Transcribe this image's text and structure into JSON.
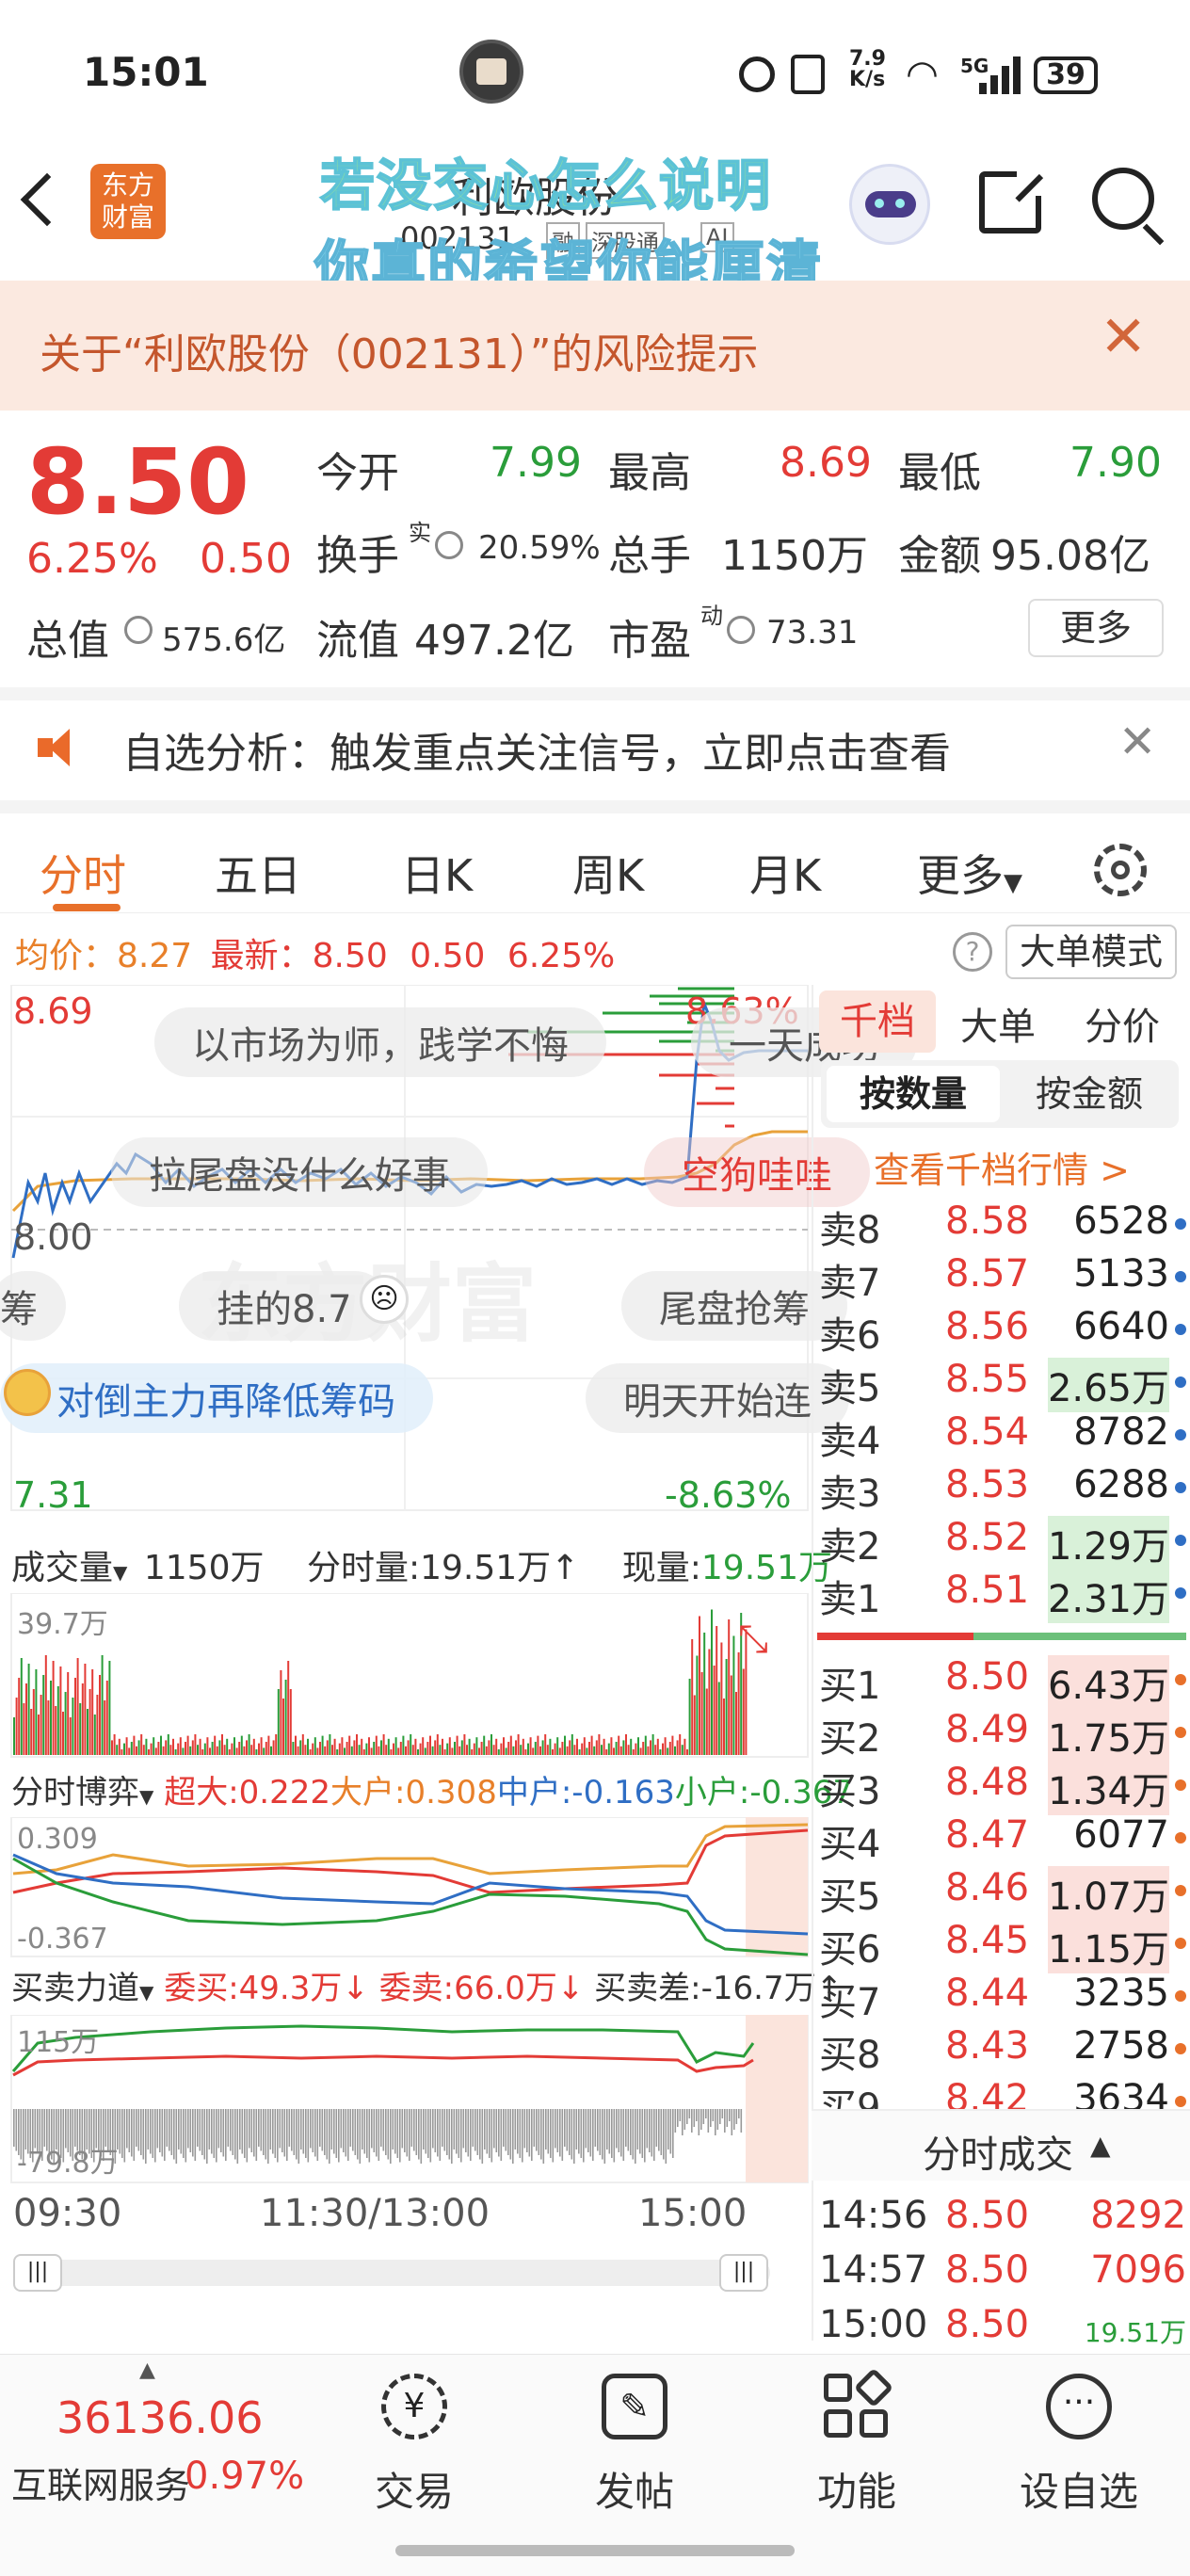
{
  "status_bar": {
    "time": "15:01",
    "net_speed_top": "7.9",
    "net_speed_unit": "K/s",
    "signal_label": "5G",
    "battery": "39"
  },
  "nav": {
    "logo_top": "东方",
    "logo_bottom": "财富",
    "stock_name": "利欧股份",
    "stock_code": "002131",
    "tags": [
      "融",
      "深股通",
      "AI"
    ],
    "overlay_line1": "若没交心怎么说明",
    "overlay_line2": "你真的希望你能厘清"
  },
  "banner": {
    "text": "关于“利欧股份（002131）”的风险提示"
  },
  "quote": {
    "price": "8.50",
    "change_pct": "6.25%",
    "change": "0.50",
    "open_label": "今开",
    "open": "7.99",
    "high_label": "最高",
    "high": "8.69",
    "low_label": "最低",
    "low": "7.90",
    "turnover_label": "换手",
    "turnover_sup": "实",
    "turnover": "20.59%",
    "volume_label": "总手",
    "volume": "1150万",
    "amount_label": "金额",
    "amount": "95.08亿",
    "mktcap_label": "总值",
    "mktcap": "575.6亿",
    "float_label": "流值",
    "float": "497.2亿",
    "pe_label": "市盈",
    "pe_sup": "动",
    "pe": "73.31",
    "more": "更多"
  },
  "notice": {
    "text": "自选分析：触发重点关注信号，立即点击查看"
  },
  "tabs": [
    "分时",
    "五日",
    "日K",
    "周K",
    "月K",
    "更多"
  ],
  "chart": {
    "avg_label": "均价：",
    "avg": "8.27",
    "latest_label": "最新：",
    "latest": "8.50",
    "latest_chg": "0.50",
    "latest_pct": "6.25%",
    "mode_button": "大单模式",
    "y_high": "8.69",
    "y_high_pct": "8.63%",
    "y_mid": "8.00",
    "y_low": "7.31",
    "y_low_pct": "-8.63%",
    "vol_label": "成交量",
    "vol_total": "1150万",
    "vol_fs_label": "分时量:",
    "vol_fs": "19.51万↑",
    "vol_now_label": "现量:",
    "vol_now": "19.51万",
    "vol_max": "39.7万",
    "game_label": "分时博弈",
    "game_super_label": "超大:",
    "game_super": "0.222",
    "game_big_label": "大户:",
    "game_big": "0.308",
    "game_mid_label": "中户:",
    "game_mid": "-0.163",
    "game_small_label": "小户:",
    "game_small": "-0.367",
    "game_top": "0.309",
    "game_bot": "-0.367",
    "force_label": "买卖力道",
    "force_buy_label": "委买:",
    "force_buy": "49.3万↓",
    "force_sell_label": "委卖:",
    "force_sell": "66.0万↓",
    "force_diff_label": "买卖差:",
    "force_diff": "-16.7万↑",
    "force_top": "115万",
    "force_bot": "-79.8万",
    "time_start": "09:30",
    "time_mid": "11:30/13:00",
    "time_end": "15:00"
  },
  "danmaku": [
    "以市场为师，践学不悔",
    "一天成功",
    "拉尾盘没什么好事",
    "空狗哇哇",
    "挂的8.7",
    "尾盘抢筹",
    "对倒主力再降低筹码",
    "明天开始连",
    "筹",
    "东方财富"
  ],
  "orderbook": {
    "tabs": [
      "千档",
      "大单",
      "分价"
    ],
    "sub_tabs": [
      "按数量",
      "按金额"
    ],
    "link": "查看千档行情 >",
    "sells": [
      {
        "l": "卖8",
        "p": "8.58",
        "v": "6528"
      },
      {
        "l": "卖7",
        "p": "8.57",
        "v": "5133"
      },
      {
        "l": "卖6",
        "p": "8.56",
        "v": "6640"
      },
      {
        "l": "卖5",
        "p": "8.55",
        "v": "2.65万"
      },
      {
        "l": "卖4",
        "p": "8.54",
        "v": "8782"
      },
      {
        "l": "卖3",
        "p": "8.53",
        "v": "6288"
      },
      {
        "l": "卖2",
        "p": "8.52",
        "v": "1.29万"
      },
      {
        "l": "卖1",
        "p": "8.51",
        "v": "2.31万"
      }
    ],
    "buys": [
      {
        "l": "买1",
        "p": "8.50",
        "v": "6.43万"
      },
      {
        "l": "买2",
        "p": "8.49",
        "v": "1.75万"
      },
      {
        "l": "买3",
        "p": "8.48",
        "v": "1.34万"
      },
      {
        "l": "买4",
        "p": "8.47",
        "v": "6077"
      },
      {
        "l": "买5",
        "p": "8.46",
        "v": "1.07万"
      },
      {
        "l": "买6",
        "p": "8.45",
        "v": "1.15万"
      },
      {
        "l": "买7",
        "p": "8.44",
        "v": "3235"
      },
      {
        "l": "买8",
        "p": "8.43",
        "v": "2758"
      },
      {
        "l": "买9",
        "p": "8.42",
        "v": "3634"
      }
    ],
    "trades_title": "分时成交",
    "trades": [
      {
        "t": "14:56",
        "p": "8.50",
        "v": "8292"
      },
      {
        "t": "14:57",
        "p": "8.50",
        "v": "7096"
      },
      {
        "t": "15:00",
        "p": "8.50",
        "v": "19.51万"
      }
    ]
  },
  "bottom_nav": {
    "index_value": "36136.06",
    "index_name": "互联网服务",
    "index_pct": "0.97%",
    "items": [
      "交易",
      "发帖",
      "功能",
      "设自选"
    ]
  },
  "colors": {
    "up": "#e33b36",
    "down": "#2a9d3a",
    "accent": "#e8702a"
  }
}
